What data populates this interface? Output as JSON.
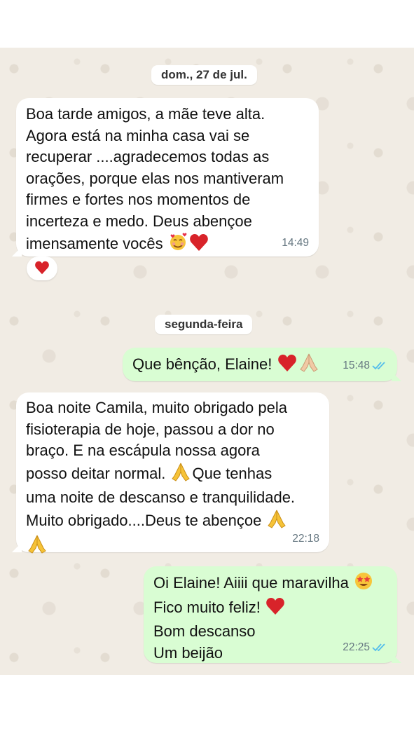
{
  "colors": {
    "incoming_bubble": "#ffffff",
    "outgoing_bubble": "#d9fdd3",
    "chat_background": "#f1ece4",
    "read_ticks": "#53bdeb",
    "timestamp": "#667781"
  },
  "date_separators": [
    {
      "label": "dom., 27 de jul."
    },
    {
      "label": "segunda-feira"
    }
  ],
  "messages": [
    {
      "direction": "incoming",
      "lines": [
        "Boa tarde amigos, a mãe teve alta.",
        "Agora está na  minha casa vai se",
        "recuperar ....agradecemos todas as",
        "orações,  porque elas nos mantiveram",
        "firmes e fortes nos momentos de",
        "incerteza e medo. Deus abençoe",
        "imensamente vocês"
      ],
      "trailing_emojis": [
        "smiling-face-with-hearts",
        "red-heart"
      ],
      "time": "14:49",
      "reaction": "red-heart"
    },
    {
      "direction": "outgoing",
      "lines": [
        "Que bênção, Elaine!"
      ],
      "trailing_emojis": [
        "red-heart",
        "folded-hands"
      ],
      "time": "15:48",
      "status": "read"
    },
    {
      "direction": "incoming",
      "lines": [
        "Boa noite Camila, muito obrigado pela",
        "fisioterapia de hoje, passou a dor no",
        "braço.  E na escápula nossa agora",
        "posso deitar normal.",
        "uma noite de descanso e tranquilidade.",
        "Muito obrigado....Deus te abençoe"
      ],
      "line4_suffix": "Que tenhas",
      "time": "22:18"
    },
    {
      "direction": "outgoing",
      "lines": [
        "Oi Elaine! Aiiii que maravilha",
        "Fico muito feliz!",
        "Bom descanso",
        "Um beijão"
      ],
      "time": "22:25",
      "status": "read"
    }
  ]
}
